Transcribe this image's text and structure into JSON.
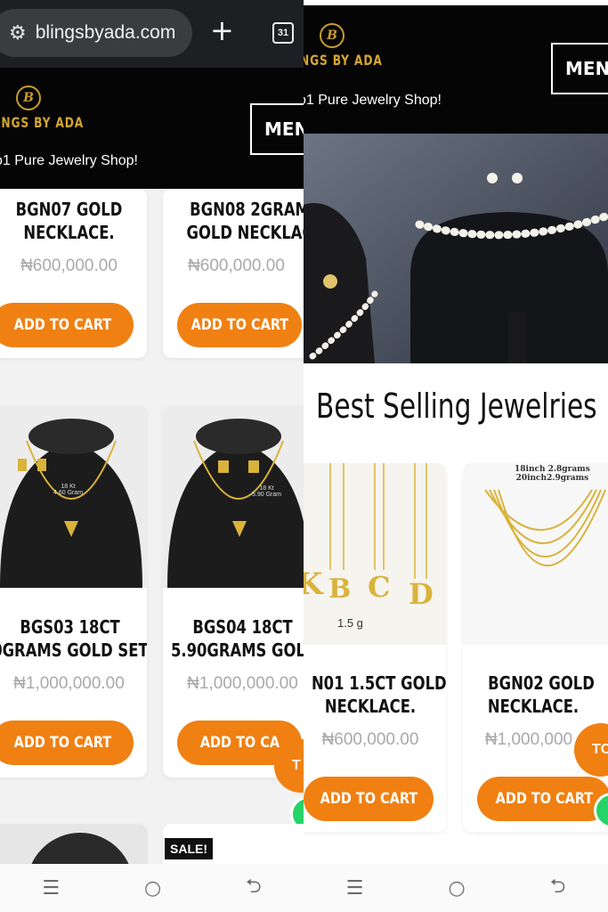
{
  "browser": {
    "url": "blingsbyada.com",
    "tab_count": "31",
    "site_icon": "tune-icon",
    "new_tab_icon": "plus-icon"
  },
  "site": {
    "logo_letter": "B",
    "logo_text_left": "INGS BY ADA",
    "logo_text_right": "NGS BY ADA",
    "tagline_left": "o1 Pure Jewelry Shop!",
    "tagline_right": "o1 Pure Jewelry Shop!",
    "menu_left": "MENU",
    "menu_right": "MENU",
    "accent_color": "#f08012",
    "brand_gold": "#d4a52f"
  },
  "left": {
    "products": [
      {
        "title_1": "BGN07 GOLD",
        "title_2": "NECKLACE.",
        "price": "₦600,000.00",
        "cta": "ADD TO CART"
      },
      {
        "title_1": "BGN08 2GRAM",
        "title_2": "GOLD NECKLAC",
        "price": "₦600,000.00",
        "cta": "ADD TO CART"
      },
      {
        "title_1": "BGS03 18CT",
        "title_2": "0GRAMS GOLD SET",
        "price": "₦1,000,000.00",
        "cta": "ADD TO CART",
        "label_1": "18 Kt",
        "label_2": "4.60 Gram"
      },
      {
        "title_1": "BGS04 18CT",
        "title_2": "5.90GRAMS GOLI",
        "price": "₦1,000,000.00",
        "cta": "ADD TO CA",
        "label_1": "18 Kt",
        "label_2": "5.90 Gram"
      }
    ],
    "sale_badge": "SALE!",
    "totop_text": "T"
  },
  "right": {
    "section_title": "Best Selling Jewelries",
    "products": [
      {
        "title_1": "N01 1.5CT GOLD",
        "title_2": "NECKLACE.",
        "price": "₦600,000.00",
        "cta": "ADD TO CART",
        "img_label": "1.5 g",
        "letters": [
          "K",
          "B",
          "C",
          "D"
        ]
      },
      {
        "title_1": "BGN02 GOLD",
        "title_2": "NECKLACE.",
        "price": "₦1,000,000",
        "cta": "ADD TO CART",
        "img_label_1": "18inch 2.8grams",
        "img_label_2": "20inch2.9grams"
      }
    ],
    "totop_text": "TC"
  },
  "navbar": {
    "recents": "☰",
    "home": "○",
    "back": "⮌"
  }
}
